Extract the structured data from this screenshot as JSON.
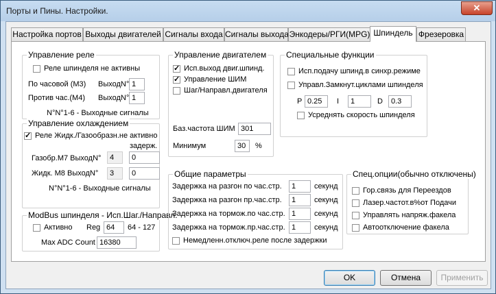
{
  "window": {
    "title": "Порты и Пины.  Настройки.",
    "close": "✕"
  },
  "tabs": [
    "Настройка портов",
    "Выходы двигателей",
    "Сигналы входа",
    "Сигналы выхода",
    "Энкодеры/РГИ(MPG)",
    "Шпиндель",
    "Фрезеровка"
  ],
  "active_tab": "Шпиндель",
  "relay": {
    "title": "Управление реле",
    "disabled_label": "Реле шпинделя не активны",
    "disabled_checked": false,
    "cw_label": "По часовой (M3)",
    "cw_out_label": "ВыходN°",
    "cw_value": "1",
    "ccw_label": "Против час.(M4)",
    "ccw_out_label": "ВыходN°",
    "ccw_value": "1",
    "note": "N°N°1-6 - Выходные сигналы"
  },
  "cooling": {
    "title": "Управление охлаждением",
    "disabled_label": "Реле Жидк./Газообразн.не активно",
    "disabled_checked": true,
    "delay_label": "задерж.",
    "mist_label": "Газобр.M7 ВыходN°",
    "mist_value": "4",
    "mist_delay": "0",
    "flood_label": "Жидк. M8 ВыходN°",
    "flood_value": "3",
    "flood_delay": "0",
    "note": "N°N°1-6 - Выходные сигналы"
  },
  "modbus": {
    "title": "ModBus шпинделя - Исп.Шаг./Направл.",
    "active_label": "Активно",
    "active_checked": false,
    "reg_label": "Reg",
    "reg_value": "64",
    "reg_range": "64 - 127",
    "max_adc_label": "Max ADC Count",
    "max_adc_value": "16380"
  },
  "motor": {
    "title": "Управление двигателем",
    "use_output_label": "Исп.выход двиг.шпинд.",
    "use_output_checked": true,
    "pwm_label": "Управление ШИМ",
    "pwm_checked": true,
    "stepdir_label": "Шаг/Направл.двигателя",
    "stepdir_checked": false,
    "base_freq_label": "Баз.частота ШИМ",
    "base_freq_value": "301",
    "min_label": "Минимум",
    "min_value": "30",
    "min_unit": "%"
  },
  "special": {
    "title": "Специальные функции",
    "sync_label": "Исп.подачу шпинд.в синхр.режиме",
    "sync_checked": false,
    "closed_loop_label": "Управл.Замкнут.циклами шпинделя",
    "closed_loop_checked": false,
    "p_label": "P",
    "p_value": "0.25",
    "i_label": "I",
    "i_value": "1",
    "d_label": "D",
    "d_value": "0.3",
    "avg_label": "Усреднять скорость шпинделя",
    "avg_checked": false
  },
  "general": {
    "title": "Общие параметры",
    "rows": [
      {
        "label": "Задержка на разгон по час.стр.",
        "value": "1",
        "unit": "секунд"
      },
      {
        "label": "Задержка на разгон пр.час.стр.",
        "value": "1",
        "unit": "секунд"
      },
      {
        "label": "Задержка на тормож.по час.стр.",
        "value": "1",
        "unit": "секунд"
      },
      {
        "label": "Задержка на тормож.пр.час.стр.",
        "value": "1",
        "unit": "секунд"
      }
    ],
    "immediate_label": "Немедленн.отключ.реле после задержки",
    "immediate_checked": false
  },
  "options": {
    "title": "Спец.опции(обычно отключены)",
    "items": [
      {
        "label": "Гор.связь для Переездов",
        "checked": false
      },
      {
        "label": "Лазер.частот.в%от Подачи",
        "checked": false
      },
      {
        "label": "Управлять напряж.факела",
        "checked": false
      },
      {
        "label": "Автоотключение факела",
        "checked": false
      }
    ]
  },
  "buttons": {
    "ok": "OK",
    "cancel": "Отмена",
    "apply": "Применить"
  }
}
